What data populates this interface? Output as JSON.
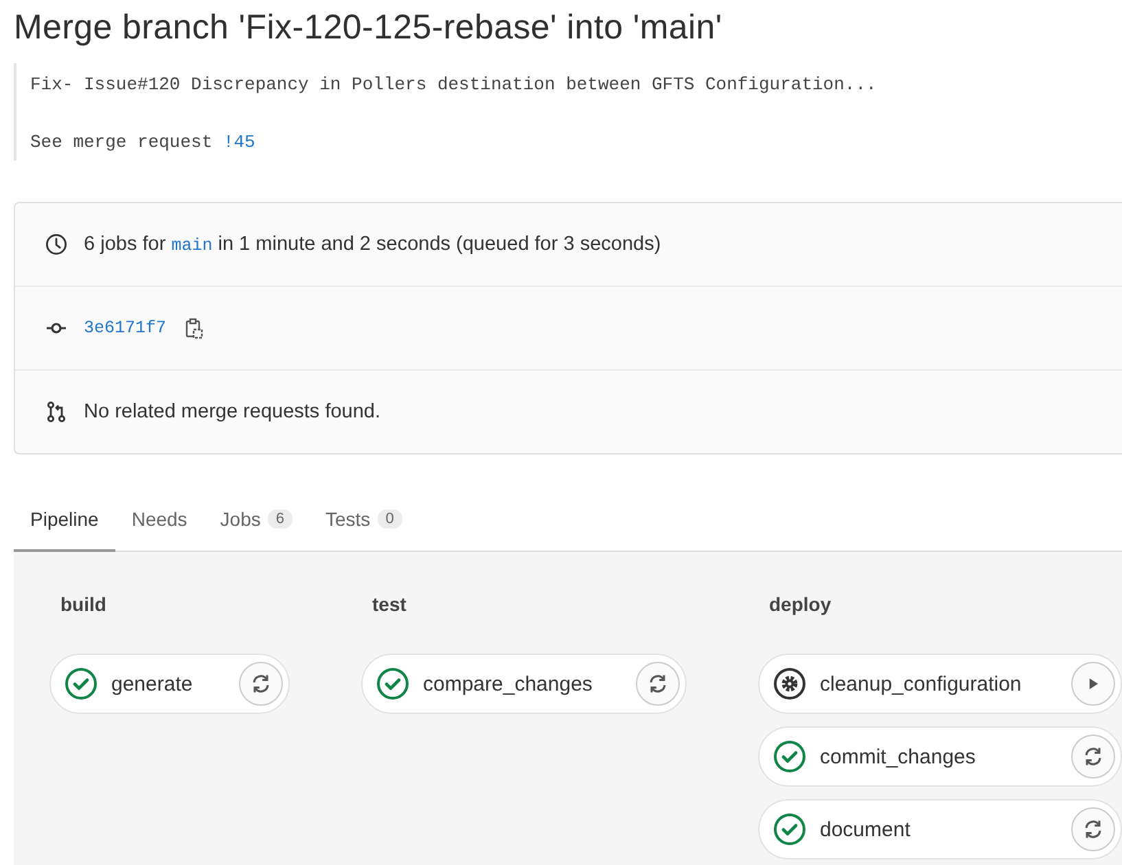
{
  "title": "Merge branch 'Fix-120-125-rebase' into 'main'",
  "commit_message": {
    "line": "Fix- Issue#120 Discrepancy in Pollers destination between GFTS Configuration...",
    "prefix": "See merge request ",
    "link": "!45"
  },
  "info": {
    "jobs_count": "6 jobs for",
    "branch": "main",
    "duration": "in 1 minute and 2 seconds (queued for 3 seconds)",
    "sha": "3e6171f7",
    "merge_requests": "No related merge requests found."
  },
  "tabs": [
    {
      "label": "Pipeline",
      "selected": true
    },
    {
      "label": "Needs",
      "selected": false
    },
    {
      "label": "Jobs",
      "count": "6",
      "selected": false
    },
    {
      "label": "Tests",
      "count": "0",
      "selected": false
    }
  ],
  "stages": [
    {
      "name": "build",
      "jobs": [
        {
          "name": "generate",
          "kind": "success"
        }
      ]
    },
    {
      "name": "test",
      "jobs": [
        {
          "name": "compare_changes",
          "kind": "success"
        }
      ]
    },
    {
      "name": "deploy",
      "jobs": [
        {
          "name": "cleanup_configuration",
          "kind": "manual"
        },
        {
          "name": "commit_changes",
          "kind": "success"
        },
        {
          "name": "document",
          "kind": "success"
        }
      ]
    }
  ]
}
